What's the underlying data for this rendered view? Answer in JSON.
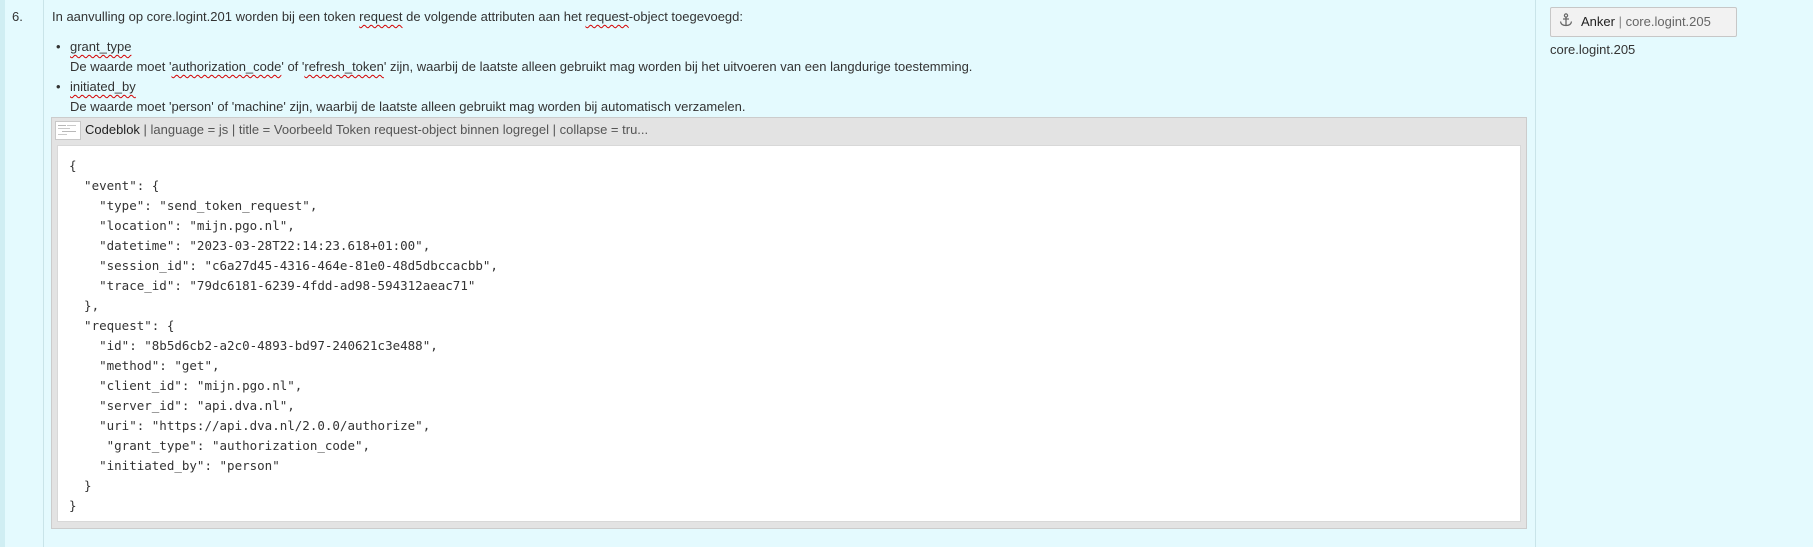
{
  "list_number": "6.",
  "intro": {
    "part1": "In aanvulling op core.logint.201 worden bij een token ",
    "word_request": "request",
    "part2": " de volgende attributen aan het ",
    "word_request2": "request",
    "part3": "-object toegevoegd:"
  },
  "attributes": [
    {
      "name": "grant_type",
      "desc_pre": "De waarde moet '",
      "desc_v1": "authorization_code",
      "desc_mid": "' of '",
      "desc_v2": "refresh_token",
      "desc_post": "' zijn, waarbij de laatste alleen gebruikt mag worden bij het uitvoeren van een langdurige toestemming."
    },
    {
      "name": "initiated_by",
      "desc": "De waarde moet 'person' of 'machine' zijn, waarbij de laatste alleen gebruikt mag worden bij automatisch verzamelen."
    }
  ],
  "code_macro": {
    "title": "Codeblok",
    "params": " | language = js | title = Voorbeeld Token request-object binnen logregel | collapse = tru...",
    "code": "{\n  \"event\": {\n    \"type\": \"send_token_request\",\n    \"location\": \"mijn.pgo.nl\",\n    \"datetime\": \"2023-03-28T22:14:23.618+01:00\",\n    \"session_id\": \"c6a27d45-4316-464e-81e0-48d5dbccacbb\",\n    \"trace_id\": \"79dc6181-6239-4fdd-ad98-594312aeac71\"\n  },\n  \"request\": {\n    \"id\": \"8b5d6cb2-a2c0-4893-bd97-240621c3e488\",\n    \"method\": \"get\",\n    \"client_id\": \"mijn.pgo.nl\",\n    \"server_id\": \"api.dva.nl\",\n    \"uri\": \"https://api.dva.nl/2.0.0/authorize\",\n     \"grant_type\": \"authorization_code\",\n    \"initiated_by\": \"person\"\n  }\n}"
  },
  "anchor": {
    "icon": "anchor-icon",
    "label": "Anker",
    "separator": " | ",
    "id": "core.logint.205"
  },
  "side_label": "core.logint.205"
}
